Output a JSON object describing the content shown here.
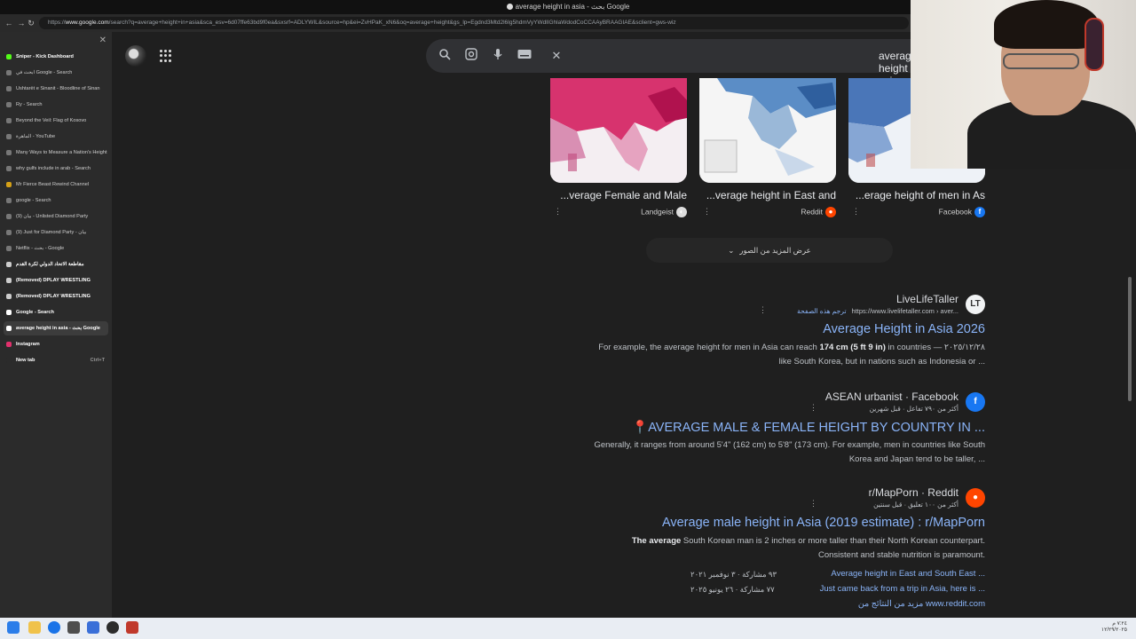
{
  "window": {
    "title": "average height in asia - بحث Google"
  },
  "browser": {
    "url_prefix": "https://",
    "url_domain": "www.google.com",
    "url_rest": "/search?q=average+height+in+asia&sca_esv=6d07ffe63bd9f0ea&sxsrf=ADLYWIL&source=hp&ei=ZvHPaK_xN6&oq=average+height&gs_lp=Egdnd3Mtd2l6Ig5hdmVyYWdlIGhlaWdodCoCCAAyBRAAGIAE&sclient=gws-wiz"
  },
  "sidebar": {
    "tabs": [
      {
        "label": "Sniper - Kick Dashboard",
        "bold": true,
        "color": "#53fc18"
      },
      {
        "label": "ابحث في Google - Search",
        "bold": false,
        "color": "#777777"
      },
      {
        "label": "Ushtarët e Sinanit - Bloodline of Sinan",
        "bold": false,
        "color": "#777777"
      },
      {
        "label": "Ry - Search",
        "bold": false,
        "color": "#777777"
      },
      {
        "label": "Beyond the Veil: Flag of Kosovo",
        "bold": false,
        "color": "#777777"
      },
      {
        "label": "الماهرة - YouTube",
        "bold": false,
        "color": "#777777"
      },
      {
        "label": "Many Ways to Measure a Nation's Height",
        "bold": false,
        "color": "#777777"
      },
      {
        "label": "why gulfs include in arab - Search",
        "bold": false,
        "color": "#777777"
      },
      {
        "label": "Mr Fierce Beast Rewind Channel",
        "bold": false,
        "color": "#d4a017"
      },
      {
        "label": "google - Search",
        "bold": false,
        "color": "#777777"
      },
      {
        "label": "(9) بيان - Unlisted Diamond Party",
        "bold": false,
        "color": "#777777"
      },
      {
        "label": "(9) Just for Diamond Party - بيان",
        "bold": false,
        "color": "#777777"
      },
      {
        "label": "Netflix - بحث - Google",
        "bold": false,
        "color": "#777777"
      },
      {
        "label": "مقاطعة الاتحاد الدولي لكرة القدم",
        "bold": true,
        "color": "#cccccc"
      },
      {
        "label": "(Removed) DPLAY WRESTLING",
        "bold": true,
        "color": "#cccccc"
      },
      {
        "label": "(Removed) DPLAY WRESTLING",
        "bold": true,
        "color": "#cccccc"
      },
      {
        "label": "Google - Search",
        "bold": true,
        "color": "#ffffff"
      },
      {
        "label": "average height in asia - بحث Google",
        "bold": true,
        "color": "#ffffff",
        "active": true
      },
      {
        "label": "Instagram",
        "bold": true,
        "color": "#e1306c"
      },
      {
        "label": "New tab",
        "bold": true,
        "color": "#2b2b2b",
        "shortcut": "Ctrl+T"
      }
    ]
  },
  "search": {
    "query": "average height in asia"
  },
  "images": [
    {
      "caption": "...verage Female and Male",
      "source": "Landgeist",
      "source_color": "#dddddd",
      "source_glyph": "◐"
    },
    {
      "caption": "...verage height in East and",
      "source": "Reddit",
      "source_color": "#ff4500",
      "source_glyph": "●"
    },
    {
      "caption": "...erage height of men in As",
      "source": "Facebook",
      "source_color": "#1877f2",
      "source_glyph": "f"
    }
  ],
  "more_images_label": "عرض المزيد من الصور",
  "results": [
    {
      "site": "LiveLifeTaller",
      "url": "https://www.livelifetaller.com › aver...",
      "translate": "ترجم هذه الصفحة",
      "title": "Average Height in Asia 2026",
      "snippet_1_pre": "For example, the average height for men in Asia can reach ",
      "snippet_1_bold": "174 cm (5 ft 9 in)",
      "snippet_1_post": " in countries — ٢٠٢٥/١٢/٢٨",
      "snippet_2": "like South Korea, but in nations such as Indonesia or ...",
      "fav_bg": "#f1f3f4",
      "fav_fg": "#333333",
      "fav_glyph": "LT"
    },
    {
      "site": "ASEAN urbanist · Facebook",
      "url": "أكثر من ٧٩٠ تفاعل · قبل شهرين",
      "title": "📍AVERAGE MALE & FEMALE HEIGHT BY COUNTRY IN ...",
      "snippet_1": "Generally, it ranges from around 5'4\" (162 cm) to 5'8\" (173 cm). For example, men in countries like South",
      "snippet_2": "Korea and Japan tend to be taller, ...",
      "fav_bg": "#1877f2",
      "fav_fg": "#ffffff",
      "fav_glyph": "f"
    },
    {
      "site": "r/MapPorn · Reddit",
      "url": "أكثر من ١٠٠ تعليق · قبل سنتين",
      "title": "Average male height in Asia (2019 estimate) : r/MapPorn",
      "snippet_1_bold": "The average",
      "snippet_1_post": " South Korean man is 2 inches or more taller than their North Korean counterpart.",
      "snippet_2": "Consistent and stable nutrition is paramount.",
      "fav_bg": "#ff4500",
      "fav_fg": "#ffffff",
      "fav_glyph": "●",
      "sublinks": [
        {
          "text": "Average height in East and South East ...",
          "meta": "٩٣ مشاركة · ٣ نوفمبر ٢٠٢١"
        },
        {
          "text": "Just came back from a trip in Asia, here is ...",
          "meta": "٧٧ مشاركة · ٢٦ يونيو ٢٠٢٥"
        }
      ],
      "more_from": "مزيد من النتائج من www.reddit.com"
    }
  ],
  "taskbar": {
    "time": "٧:٢٤ م",
    "date": "١٢/٢٩/٢٠٢٥"
  }
}
